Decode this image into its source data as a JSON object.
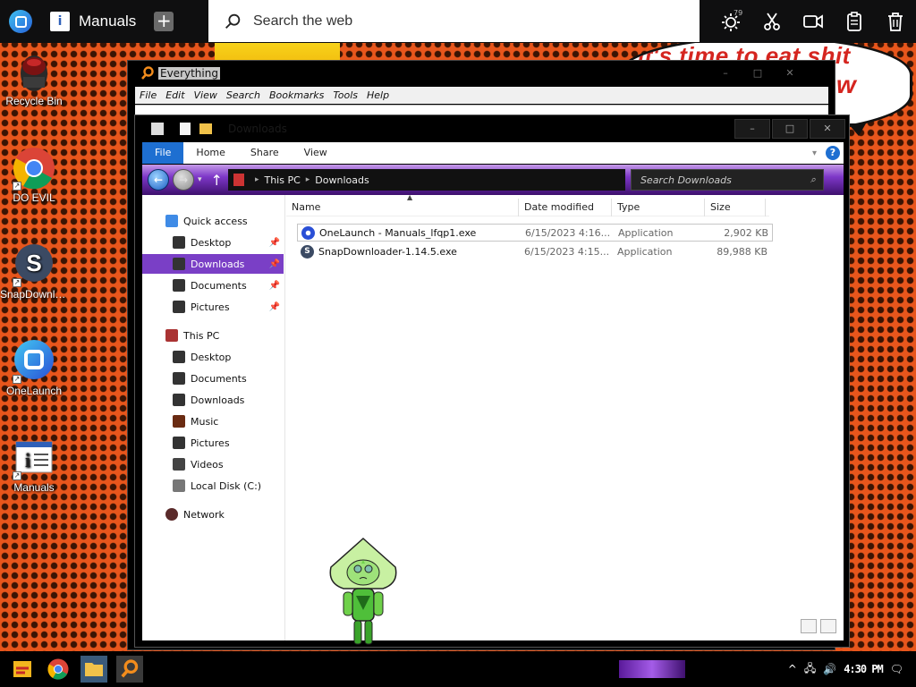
{
  "wallpaper": {
    "bubble_line1": "it's time to eat shit",
    "bubble_line2": "w"
  },
  "topbar": {
    "tab_label": "Manuals",
    "search_placeholder": "Search the web",
    "badge_count": "79"
  },
  "desktop_icons": [
    {
      "label": "Recycle Bin",
      "icon": "recycle-bin-icon"
    },
    {
      "label": "DO EVIL",
      "icon": "chrome-icon"
    },
    {
      "label": "SnapDownlo...",
      "icon": "snapdownloader-icon"
    },
    {
      "label": "OneLaunch",
      "icon": "onelaunch-icon"
    },
    {
      "label": "Manuals",
      "icon": "manuals-icon"
    }
  ],
  "everything": {
    "title": "Everything",
    "menu": [
      "File",
      "Edit",
      "View",
      "Search",
      "Bookmarks",
      "Tools",
      "Help"
    ]
  },
  "explorer": {
    "title": "Downloads",
    "ribbon_tabs": [
      "File",
      "Home",
      "Share",
      "View"
    ],
    "breadcrumb": [
      "This PC",
      "Downloads"
    ],
    "search_placeholder": "Search Downloads",
    "nav": {
      "quick_access": "Quick access",
      "quick_items": [
        "Desktop",
        "Downloads",
        "Documents",
        "Pictures"
      ],
      "this_pc": "This PC",
      "pc_items": [
        "Desktop",
        "Documents",
        "Downloads",
        "Music",
        "Pictures",
        "Videos",
        "Local Disk (C:)"
      ],
      "network": "Network"
    },
    "columns": [
      "Name",
      "Date modified",
      "Type",
      "Size"
    ],
    "files": [
      {
        "name": "OneLaunch - Manuals_lfqp1.exe",
        "date": "6/15/2023 4:16...",
        "type": "Application",
        "size": "2,902 KB"
      },
      {
        "name": "SnapDownloader-1.14.5.exe",
        "date": "6/15/2023 4:15...",
        "type": "Application",
        "size": "89,988 KB"
      }
    ]
  },
  "taskbar": {
    "clock": "4:30 PM"
  },
  "colors": {
    "accent_purple": "#7a3fc6",
    "ribbon_blue": "#1e6fd1",
    "wallpaper_orange": "#e8561c"
  }
}
